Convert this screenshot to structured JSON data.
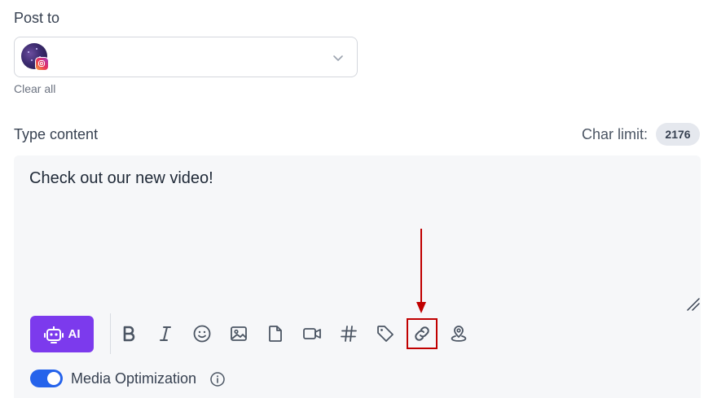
{
  "post_to": {
    "label": "Post to",
    "account": {
      "avatar_icon": "avatar-image",
      "network_icon": "instagram-icon"
    },
    "dropdown_icon": "chevron-down-icon",
    "clear_all": "Clear all"
  },
  "content": {
    "label": "Type content",
    "char_limit_label": "Char limit:",
    "char_limit_value": "2176",
    "text": "Check out our new video!"
  },
  "toolbar": {
    "ai_label": "AI",
    "tools": [
      {
        "name": "bold-icon"
      },
      {
        "name": "italic-icon"
      },
      {
        "name": "emoji-icon"
      },
      {
        "name": "image-icon"
      },
      {
        "name": "file-icon"
      },
      {
        "name": "video-icon"
      },
      {
        "name": "hashtag-icon"
      },
      {
        "name": "tag-icon"
      },
      {
        "name": "link-icon"
      },
      {
        "name": "location-icon"
      }
    ],
    "highlight_color": "#c00000"
  },
  "media_optimization": {
    "label": "Media Optimization",
    "enabled": true
  },
  "colors": {
    "accent": "#7c3aed",
    "toggle": "#2563eb",
    "annotation": "#c00000"
  }
}
